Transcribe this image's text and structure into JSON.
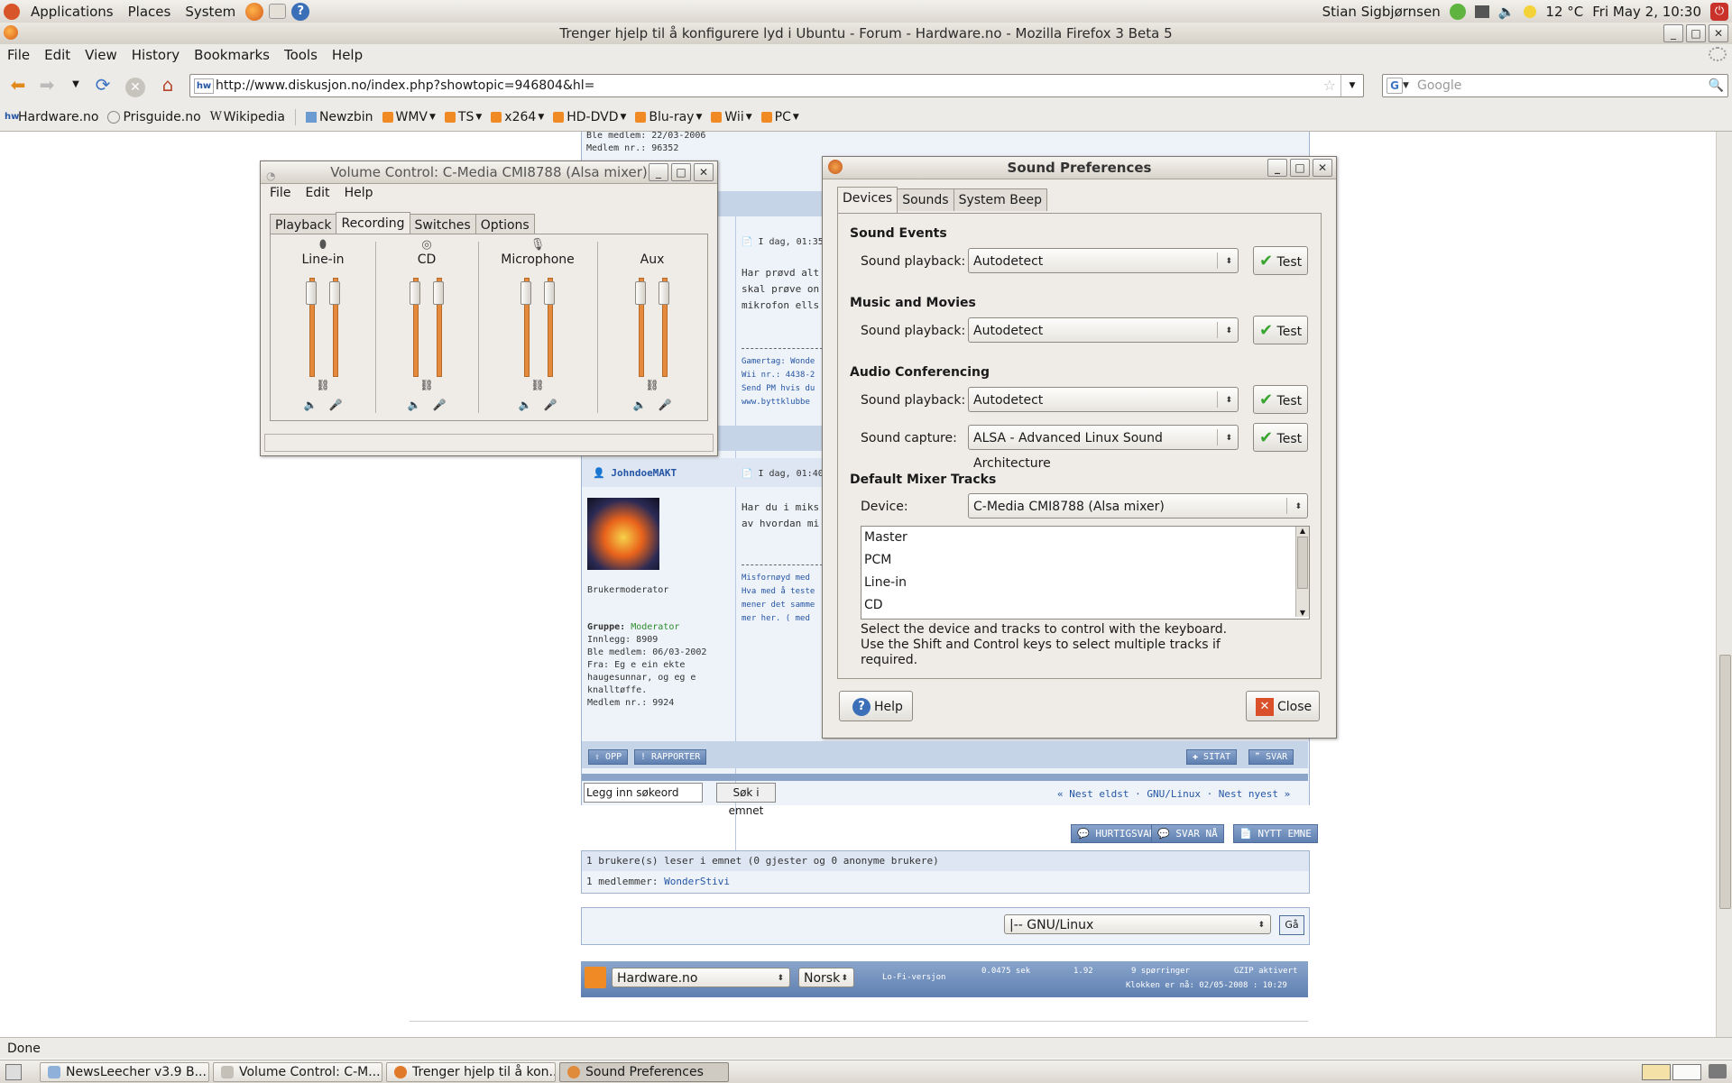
{
  "panel": {
    "menus": [
      "Applications",
      "Places",
      "System"
    ],
    "user": "Stian Sigbjørnsen",
    "weather": "12 °C",
    "clock": "Fri May  2, 10:30"
  },
  "firefox": {
    "title": "Trenger hjelp til å konfigurere lyd i Ubuntu - Forum - Hardware.no - Mozilla Firefox 3 Beta 5",
    "menu": [
      "File",
      "Edit",
      "View",
      "History",
      "Bookmarks",
      "Tools",
      "Help"
    ],
    "url": "http://www.diskusjon.no/index.php?showtopic=946804&hl=",
    "search_placeholder": "Google",
    "bookmarks": [
      "Hardware.no",
      "Prisguide.no",
      "Wikipedia",
      "Newzbin",
      "WMV",
      "TS",
      "x264",
      "HD-DVD",
      "Blu-ray",
      "Wii",
      "PC"
    ],
    "status": "Done"
  },
  "forum": {
    "top_lines": [
      "Ble medlem: 22/03-2006",
      "Medlem nr.: 96352"
    ],
    "post1": {
      "date": "I dag, 01:35",
      "lines": [
        "Har prøvd alt",
        "skal prøve on",
        "mikrofon ells"
      ],
      "sig": [
        "Gamertag: Wonde",
        "Wii nr.: 4438-2",
        "Send PM hvis du",
        "www.byttklubbe"
      ]
    },
    "post2": {
      "author": "JohndoeMAKT",
      "date": "I dag, 01:40",
      "lines": [
        "Har du i miks",
        "av hvordan mi"
      ],
      "sig": [
        "Misfornøyd med",
        "Hva med å teste",
        "mener det samme",
        "mer her. ( med"
      ],
      "role": "Brukermoderator",
      "group_label": "Gruppe:",
      "group": "Moderator",
      "info": [
        "Innlegg: 8909",
        "Ble medlem: 06/03-2002",
        "Fra: Eg e ein ekte",
        "haugesunnar, og eg e",
        "knalltøffe.",
        "Medlem nr.: 9924"
      ]
    },
    "buttons": {
      "up": "OPP",
      "report": "RAPPORTER",
      "quote": "SITAT",
      "reply": "SVAR"
    },
    "search_value": "Legg inn søkeord",
    "search_btn": "Søk i emnet",
    "nav": "« Nest eldst · GNU/Linux · Nest nyest »",
    "action_buttons": [
      "HURTIGSVAR",
      "SVAR NÅ",
      "NYTT EMNE"
    ],
    "readers": "1 brukere(s) leser i emnet (0 gjester og 0 anonyme brukere)",
    "members_label": "1 medlemmer:",
    "member": "WonderStivi",
    "jump_value": "|-- GNU/Linux",
    "go": "Gå",
    "footer": {
      "site": "Hardware.no",
      "lang": "Norsk",
      "lofi": "Lo-Fi-versjon",
      "time": "0.0475 sek",
      "load": "1.92",
      "queries": "9 spørringer",
      "gzip": "GZIP aktivert",
      "clock": "Klokken er nå: 02/05-2008 : 10:29"
    }
  },
  "volume_control": {
    "title": "Volume Control: C-Media CMI8788 (Alsa mixer)",
    "menu": [
      "File",
      "Edit",
      "Help"
    ],
    "tabs": [
      "Playback",
      "Recording",
      "Switches",
      "Options"
    ],
    "active_tab": "Recording",
    "channels": [
      {
        "name": "Line-in",
        "level": 0.9
      },
      {
        "name": "CD",
        "level": 0.9
      },
      {
        "name": "Microphone",
        "level": 0.9
      },
      {
        "name": "Aux",
        "level": 0.9
      }
    ]
  },
  "sound_prefs": {
    "title": "Sound Preferences",
    "tabs": [
      "Devices",
      "Sounds",
      "System Beep"
    ],
    "active_tab": "Devices",
    "sections": {
      "events": "Sound Events",
      "music": "Music and Movies",
      "conf": "Audio Conferencing",
      "mixer": "Default Mixer Tracks"
    },
    "labels": {
      "playback": "Sound playback:",
      "capture": "Sound capture:",
      "device": "Device:"
    },
    "values": {
      "events_playback": "Autodetect",
      "music_playback": "Autodetect",
      "conf_playback": "Autodetect",
      "conf_capture": "ALSA - Advanced Linux Sound Architecture",
      "device": "C-Media CMI8788 (Alsa mixer)"
    },
    "test": "Test",
    "tracks": [
      "Master",
      "PCM",
      "Line-in",
      "CD"
    ],
    "hint": [
      "Select the device and tracks to control with the keyboard.",
      "Use the Shift and Control keys to select multiple tracks if",
      "required."
    ],
    "help": "Help",
    "close": "Close"
  },
  "taskbar": [
    "NewsLeecher v3.9 B...",
    "Volume Control: C-M...",
    "Trenger hjelp til å kon...",
    "Sound Preferences"
  ],
  "colors": {
    "accent_orange": "#e58a3c",
    "forum_blue": "#2555a5",
    "check_green": "#3aa631"
  }
}
